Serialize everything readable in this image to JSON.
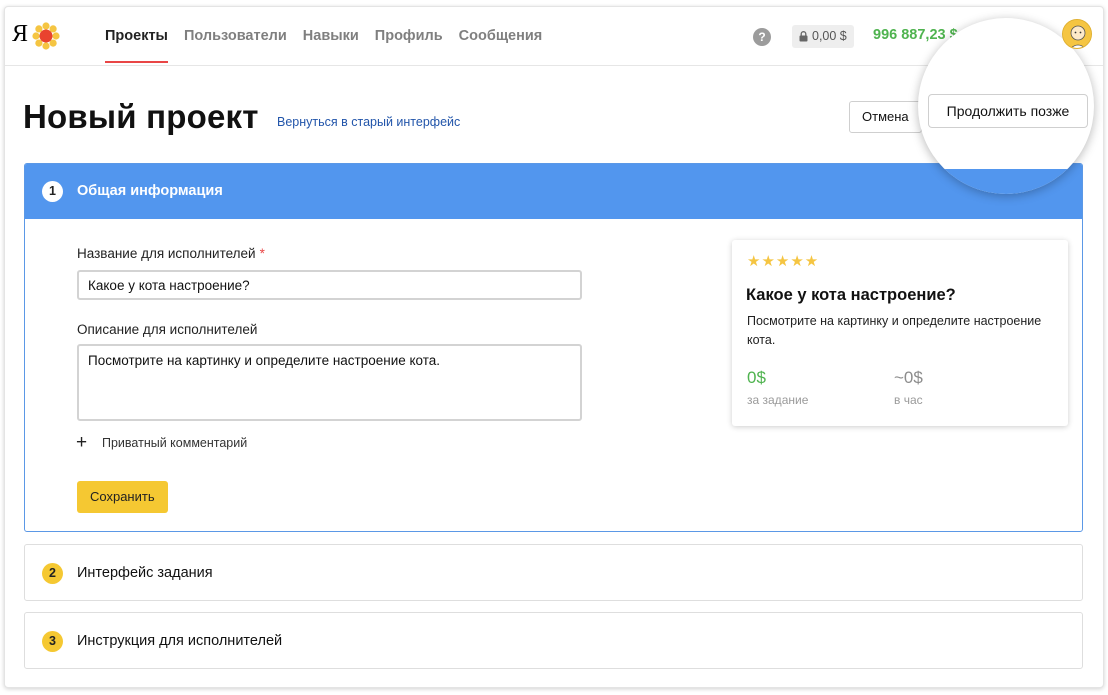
{
  "header": {
    "logo_letter": "Я",
    "nav": [
      {
        "label": "Проекты",
        "active": true
      },
      {
        "label": "Пользователи",
        "active": false
      },
      {
        "label": "Навыки",
        "active": false
      },
      {
        "label": "Профиль",
        "active": false
      },
      {
        "label": "Сообщения",
        "active": false
      }
    ],
    "help_glyph": "?",
    "locked_balance": "0,00 $",
    "balance": "996 887,23 $"
  },
  "page": {
    "title": "Новый проект",
    "old_interface_link": "Вернуться в старый интерфейс",
    "cancel_label": "Отмена",
    "continue_later_label": "Продолжить позже"
  },
  "section1": {
    "number": "1",
    "title": "Общая информация",
    "name_label": "Название для исполнителей",
    "required_mark": "*",
    "name_value": "Какое у кота настроение?",
    "desc_label": "Описание для исполнителей",
    "desc_value": "Посмотрите на картинку и определите настроение кота.",
    "private_comment": "Приватный комментарий",
    "save_label": "Сохранить"
  },
  "preview": {
    "stars": "★★★★★",
    "title": "Какое у кота настроение?",
    "description": "Посмотрите на картинку и определите настроение кота.",
    "price": "0$",
    "price_label": "за задание",
    "rate": "~0$",
    "rate_label": "в час"
  },
  "sections": [
    {
      "number": "2",
      "title": "Интерфейс задания"
    },
    {
      "number": "3",
      "title": "Инструкция для исполнителей"
    }
  ],
  "colors": {
    "accent_blue": "#5296ee",
    "accent_yellow": "#f5c832",
    "balance_green": "#4fb34f",
    "active_underline": "#e94646",
    "link_blue": "#2255aa"
  },
  "icons": [
    "yandex-flower-icon",
    "help-icon",
    "lock-icon",
    "avatar-icon",
    "plus-icon",
    "star-icon"
  ]
}
